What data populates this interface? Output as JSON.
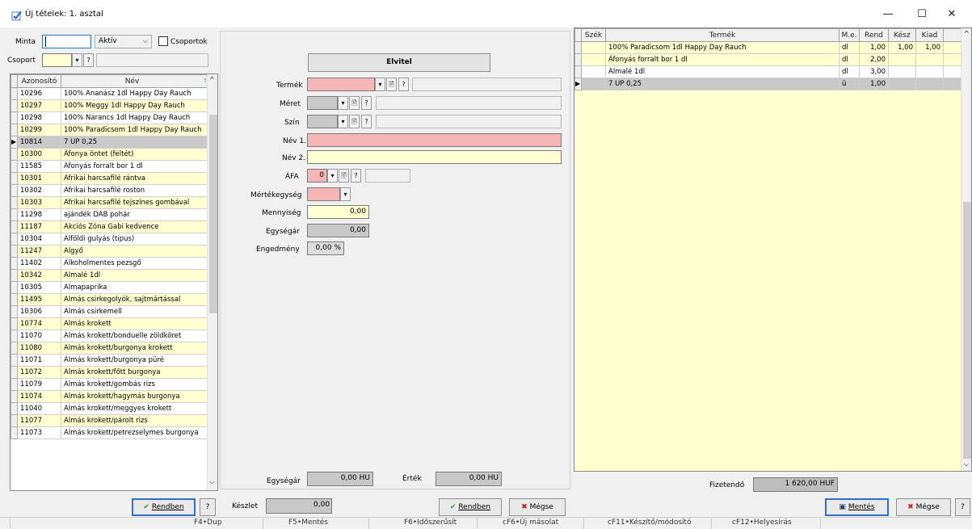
{
  "window": {
    "title": "Új tételek: 1. asztal",
    "minimize": "—",
    "maximize": "☐",
    "close": "✕"
  },
  "filter": {
    "minta_label": "Minta",
    "minta_value": "",
    "status_value": "Aktív",
    "csoportok_label": "Csoportok",
    "csoport_label": "Csoport",
    "help_mark": "?"
  },
  "product_list": {
    "columns": [
      "Azonosító",
      "Név"
    ],
    "rows": [
      {
        "id": "10296",
        "name": "100% Ananász 1dl Happy Day Rauch",
        "style": "w"
      },
      {
        "id": "10297",
        "name": "100% Meggy 1dl Happy Day Rauch",
        "style": "y"
      },
      {
        "id": "10298",
        "name": "100% Narancs 1dl Happy Day Rauch",
        "style": "w"
      },
      {
        "id": "10299",
        "name": "100% Paradicsom 1dl Happy Day Rauch",
        "style": "y"
      },
      {
        "id": "10814",
        "name": "7 UP 0,25",
        "style": "sel"
      },
      {
        "id": "10300",
        "name": "Áfonya öntet (feltét)",
        "style": "y"
      },
      {
        "id": "11585",
        "name": "Áfonyás forralt bor 1 dl",
        "style": "w"
      },
      {
        "id": "10301",
        "name": "Afrikai harcsafilé rántva",
        "style": "y"
      },
      {
        "id": "10302",
        "name": "Afrikai harcsafilé roston",
        "style": "w"
      },
      {
        "id": "10303",
        "name": "Afrikai harcsafilé tejszínes gombával",
        "style": "y"
      },
      {
        "id": "11298",
        "name": "ajándék DAB pohár",
        "style": "w"
      },
      {
        "id": "11187",
        "name": "Akciós Zóna Gabi kedvence",
        "style": "y"
      },
      {
        "id": "10304",
        "name": "Alföldi gulyás (tipus)",
        "style": "w"
      },
      {
        "id": "11247",
        "name": "Algyő",
        "style": "y"
      },
      {
        "id": "11402",
        "name": "Alkoholmentes pezsgő",
        "style": "w"
      },
      {
        "id": "10342",
        "name": "Almalé 1dl",
        "style": "y"
      },
      {
        "id": "10305",
        "name": "Almapaprika",
        "style": "w"
      },
      {
        "id": "11495",
        "name": "Almás csirkegolyók, sajtmártással",
        "style": "y"
      },
      {
        "id": "10306",
        "name": "Almás csirkemell",
        "style": "w"
      },
      {
        "id": "10774",
        "name": "Almás krokett",
        "style": "y"
      },
      {
        "id": "11070",
        "name": "Almás krokett/bonduelle zöldköret",
        "style": "w"
      },
      {
        "id": "11080",
        "name": "Almás krokett/burgonya krokett",
        "style": "y"
      },
      {
        "id": "11071",
        "name": "Almás krokett/burgonya püré",
        "style": "w"
      },
      {
        "id": "11072",
        "name": "Almás krokett/főtt burgonya",
        "style": "y"
      },
      {
        "id": "11079",
        "name": "Almás krokett/gombás rizs",
        "style": "w"
      },
      {
        "id": "11074",
        "name": "Almás krokett/hagymás burgonya",
        "style": "y"
      },
      {
        "id": "11040",
        "name": "Almás krokett/meggyes krokett",
        "style": "w"
      },
      {
        "id": "11077",
        "name": "Almás krokett/párolt rizs",
        "style": "y"
      },
      {
        "id": "11073",
        "name": "Almás krokett/petrezselymes burgonya",
        "style": "w"
      }
    ]
  },
  "form": {
    "elvitel_label": "Elvitel",
    "termek_label": "Termék",
    "meret_label": "Méret",
    "szin_label": "Szín",
    "nev1_label": "Név 1.",
    "nev2_label": "Név 2.",
    "afa_label": "ÁFA",
    "afa_value": "0",
    "mertekegyseg_label": "Mértékegység",
    "mennyiseg_label": "Mennyiség",
    "mennyiseg_value": "0,00",
    "egysegar_label": "Egységár",
    "egysegar_value": "0,00",
    "engedmeny_label": "Engedmény",
    "engedmeny_value": "0,00 %",
    "bottom_egysegar_label": "Egységár",
    "bottom_egysegar_value": "0,00 HU",
    "ertek_label": "Érték",
    "ertek_value": "0,00 HU",
    "keszlet_label": "Készlet",
    "keszlet_value": "0,00"
  },
  "order": {
    "columns": [
      "Szék",
      "Termék",
      "M.e.",
      "Rend",
      "Kész",
      "Kiad"
    ],
    "rows": [
      {
        "szek": "",
        "termek": "100% Paradicsom 1dl Happy Day Rauch",
        "me": "dl",
        "rend": "1,00",
        "kesz": "1,00",
        "kiad": "1,00",
        "style": "y"
      },
      {
        "szek": "",
        "termek": "Áfonyás forralt bor 1 dl",
        "me": "dl",
        "rend": "2,00",
        "kesz": "",
        "kiad": "",
        "style": "y"
      },
      {
        "szek": "",
        "termek": "Almalé 1dl",
        "me": "dl",
        "rend": "3,00",
        "kesz": "",
        "kiad": "",
        "style": "w"
      },
      {
        "szek": "",
        "termek": "7 UP 0,25",
        "me": "ü",
        "rend": "1,00",
        "kesz": "",
        "kiad": "",
        "style": "sel"
      }
    ],
    "fizetendo_label": "Fizetendő",
    "fizetendo_value": "1 620,00 HUF"
  },
  "buttons": {
    "rendben": "Rendben",
    "megse": "Mégse",
    "mentes": "Mentés",
    "help": "?"
  },
  "statusbar": [
    "F4•Dup",
    "F5•Mentés",
    "F6•Időszerűsít",
    "cF6•Új másolat",
    "cF11•Készítő/módosító",
    "cF12•Helyesírás"
  ]
}
